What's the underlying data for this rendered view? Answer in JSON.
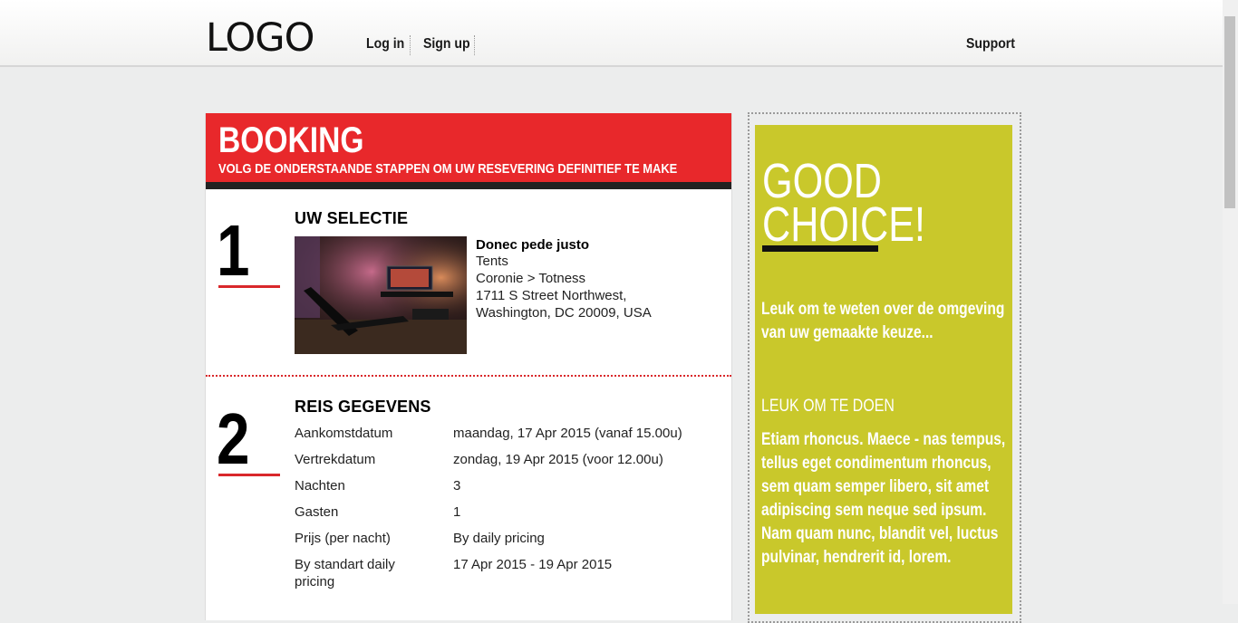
{
  "header": {
    "logo": "LOGO",
    "login_label": "Log in",
    "signup_label": "Sign up",
    "support_label": "Support"
  },
  "booking": {
    "title": "BOOKING",
    "subtitle": "VOLG DE ONDERSTAANDE STAPPEN OM UW RESEVERING DEFINITIEF TE MAKE",
    "step1": {
      "number": "1",
      "title": "UW SELECTIE",
      "name": "Donec pede justo",
      "type": "Tents",
      "route": "Coronie > Totness",
      "address_line1": "1711 S Street Northwest,",
      "address_line2": "Washington, DC 20009, USA"
    },
    "step2": {
      "number": "2",
      "title": "REIS GEGEVENS",
      "rows": [
        {
          "label": "Aankomstdatum",
          "value": "maandag, 17 Apr 2015 (vanaf 15.00u)"
        },
        {
          "label": "Vertrekdatum",
          "value": "zondag, 19 Apr 2015 (voor 12.00u)"
        },
        {
          "label": "Nachten",
          "value": "3"
        },
        {
          "label": "Gasten",
          "value": "1"
        },
        {
          "label": "Prijs (per nacht)",
          "value": "By daily pricing"
        },
        {
          "label": "By standart daily pricing",
          "value": "17 Apr 2015 - 19 Apr 2015"
        }
      ]
    }
  },
  "sidebar": {
    "heading_line1": "GOOD",
    "heading_line2": "CHOICE!",
    "intro": "Leuk om te weten over de omgeving van uw gemaakte keuze...",
    "subheading": "LEUK OM TE DOEN",
    "body": "Etiam rhoncus. Maece - nas tempus, tellus eget condimentum rhoncus, sem quam semper libero, sit amet adipiscing sem neque sed ipsum. Nam quam nunc, blandit vel, luctus pulvinar, hendrerit id, lorem."
  }
}
